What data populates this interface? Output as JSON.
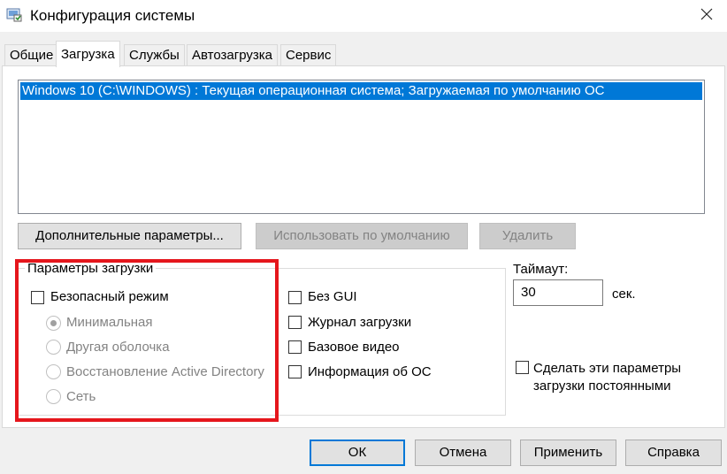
{
  "window": {
    "title": "Конфигурация системы"
  },
  "tabs": [
    {
      "label": "Общие"
    },
    {
      "label": "Загрузка"
    },
    {
      "label": "Службы"
    },
    {
      "label": "Автозагрузка"
    },
    {
      "label": "Сервис"
    }
  ],
  "os_list": {
    "selected_item": "Windows 10 (C:\\WINDOWS) : Текущая операционная система; Загружаемая по умолчанию ОС"
  },
  "boot_buttons": {
    "advanced": "Дополнительные параметры...",
    "set_default": "Использовать по умолчанию",
    "delete": "Удалить"
  },
  "boot_options": {
    "label": "Параметры загрузки",
    "safe_boot": {
      "label": "Безопасный режим",
      "checked": false
    },
    "radios": [
      {
        "label": "Минимальная",
        "selected": true
      },
      {
        "label": "Другая оболочка",
        "selected": false
      },
      {
        "label": "Восстановление Active Directory",
        "selected": false
      },
      {
        "label": "Сеть",
        "selected": false
      }
    ],
    "checkboxes": [
      {
        "label": "Без GUI",
        "checked": false
      },
      {
        "label": "Журнал загрузки",
        "checked": false
      },
      {
        "label": "Базовое видео",
        "checked": false
      },
      {
        "label": "Информация  об ОС",
        "checked": false
      }
    ]
  },
  "timeout": {
    "label": "Таймаут:",
    "value": "30",
    "unit": "сек."
  },
  "make_permanent": {
    "line1": "Сделать эти параметры",
    "line2": "загрузки постоянными",
    "checked": false
  },
  "footer": {
    "ok": "ОК",
    "cancel": "Отмена",
    "apply": "Применить",
    "help": "Справка"
  },
  "colors": {
    "selection": "#0078d7",
    "highlight_box": "#e5161c",
    "default_button_border": "#0078d7"
  }
}
